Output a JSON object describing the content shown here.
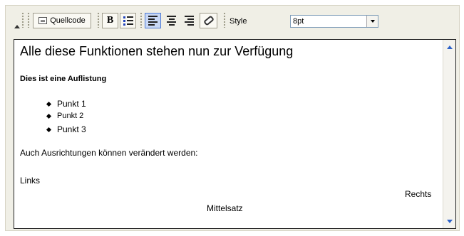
{
  "toolbar": {
    "quellcode_label": "Quellcode",
    "bold_label": "B",
    "style_label": "Style",
    "style_value": "8pt",
    "icons": [
      "toolbar-collapse-icon",
      "source-code-icon",
      "bold-icon",
      "unordered-list-icon",
      "align-left-icon",
      "align-center-icon",
      "align-right-icon",
      "eraser-icon",
      "dropdown-arrow-icon"
    ]
  },
  "editor": {
    "title": "Alle diese Funktionen stehen nun zur Verfügung",
    "subtitle": "Dies ist eine Auflistung",
    "list_items": [
      "Punkt 1",
      "Punkt 2",
      "Punkt 3"
    ],
    "alignment_text": "Auch Ausrichtungen können verändert werden:",
    "left_text": "Links",
    "right_text": "Rechts",
    "center_text": "Mittelsatz"
  },
  "colors": {
    "frame_background": "#f0efe6",
    "active_button": "#c8d8f5",
    "scroll_arrow": "#2d62c8"
  }
}
